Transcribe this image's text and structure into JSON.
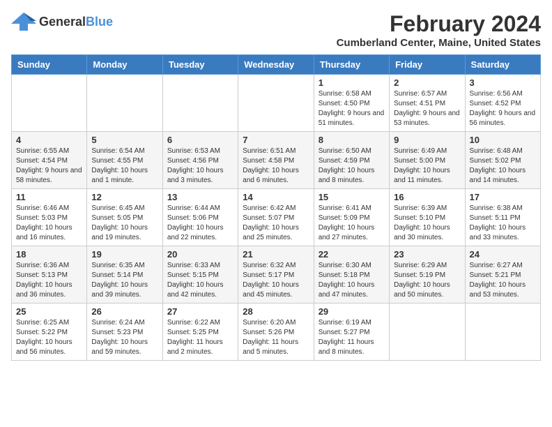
{
  "logo": {
    "line1": "General",
    "line2": "Blue"
  },
  "title": "February 2024",
  "subtitle": "Cumberland Center, Maine, United States",
  "days_of_week": [
    "Sunday",
    "Monday",
    "Tuesday",
    "Wednesday",
    "Thursday",
    "Friday",
    "Saturday"
  ],
  "weeks": [
    [
      {
        "day": "",
        "info": ""
      },
      {
        "day": "",
        "info": ""
      },
      {
        "day": "",
        "info": ""
      },
      {
        "day": "",
        "info": ""
      },
      {
        "day": "1",
        "info": "Sunrise: 6:58 AM\nSunset: 4:50 PM\nDaylight: 9 hours and 51 minutes."
      },
      {
        "day": "2",
        "info": "Sunrise: 6:57 AM\nSunset: 4:51 PM\nDaylight: 9 hours and 53 minutes."
      },
      {
        "day": "3",
        "info": "Sunrise: 6:56 AM\nSunset: 4:52 PM\nDaylight: 9 hours and 56 minutes."
      }
    ],
    [
      {
        "day": "4",
        "info": "Sunrise: 6:55 AM\nSunset: 4:54 PM\nDaylight: 9 hours and 58 minutes."
      },
      {
        "day": "5",
        "info": "Sunrise: 6:54 AM\nSunset: 4:55 PM\nDaylight: 10 hours and 1 minute."
      },
      {
        "day": "6",
        "info": "Sunrise: 6:53 AM\nSunset: 4:56 PM\nDaylight: 10 hours and 3 minutes."
      },
      {
        "day": "7",
        "info": "Sunrise: 6:51 AM\nSunset: 4:58 PM\nDaylight: 10 hours and 6 minutes."
      },
      {
        "day": "8",
        "info": "Sunrise: 6:50 AM\nSunset: 4:59 PM\nDaylight: 10 hours and 8 minutes."
      },
      {
        "day": "9",
        "info": "Sunrise: 6:49 AM\nSunset: 5:00 PM\nDaylight: 10 hours and 11 minutes."
      },
      {
        "day": "10",
        "info": "Sunrise: 6:48 AM\nSunset: 5:02 PM\nDaylight: 10 hours and 14 minutes."
      }
    ],
    [
      {
        "day": "11",
        "info": "Sunrise: 6:46 AM\nSunset: 5:03 PM\nDaylight: 10 hours and 16 minutes."
      },
      {
        "day": "12",
        "info": "Sunrise: 6:45 AM\nSunset: 5:05 PM\nDaylight: 10 hours and 19 minutes."
      },
      {
        "day": "13",
        "info": "Sunrise: 6:44 AM\nSunset: 5:06 PM\nDaylight: 10 hours and 22 minutes."
      },
      {
        "day": "14",
        "info": "Sunrise: 6:42 AM\nSunset: 5:07 PM\nDaylight: 10 hours and 25 minutes."
      },
      {
        "day": "15",
        "info": "Sunrise: 6:41 AM\nSunset: 5:09 PM\nDaylight: 10 hours and 27 minutes."
      },
      {
        "day": "16",
        "info": "Sunrise: 6:39 AM\nSunset: 5:10 PM\nDaylight: 10 hours and 30 minutes."
      },
      {
        "day": "17",
        "info": "Sunrise: 6:38 AM\nSunset: 5:11 PM\nDaylight: 10 hours and 33 minutes."
      }
    ],
    [
      {
        "day": "18",
        "info": "Sunrise: 6:36 AM\nSunset: 5:13 PM\nDaylight: 10 hours and 36 minutes."
      },
      {
        "day": "19",
        "info": "Sunrise: 6:35 AM\nSunset: 5:14 PM\nDaylight: 10 hours and 39 minutes."
      },
      {
        "day": "20",
        "info": "Sunrise: 6:33 AM\nSunset: 5:15 PM\nDaylight: 10 hours and 42 minutes."
      },
      {
        "day": "21",
        "info": "Sunrise: 6:32 AM\nSunset: 5:17 PM\nDaylight: 10 hours and 45 minutes."
      },
      {
        "day": "22",
        "info": "Sunrise: 6:30 AM\nSunset: 5:18 PM\nDaylight: 10 hours and 47 minutes."
      },
      {
        "day": "23",
        "info": "Sunrise: 6:29 AM\nSunset: 5:19 PM\nDaylight: 10 hours and 50 minutes."
      },
      {
        "day": "24",
        "info": "Sunrise: 6:27 AM\nSunset: 5:21 PM\nDaylight: 10 hours and 53 minutes."
      }
    ],
    [
      {
        "day": "25",
        "info": "Sunrise: 6:25 AM\nSunset: 5:22 PM\nDaylight: 10 hours and 56 minutes."
      },
      {
        "day": "26",
        "info": "Sunrise: 6:24 AM\nSunset: 5:23 PM\nDaylight: 10 hours and 59 minutes."
      },
      {
        "day": "27",
        "info": "Sunrise: 6:22 AM\nSunset: 5:25 PM\nDaylight: 11 hours and 2 minutes."
      },
      {
        "day": "28",
        "info": "Sunrise: 6:20 AM\nSunset: 5:26 PM\nDaylight: 11 hours and 5 minutes."
      },
      {
        "day": "29",
        "info": "Sunrise: 6:19 AM\nSunset: 5:27 PM\nDaylight: 11 hours and 8 minutes."
      },
      {
        "day": "",
        "info": ""
      },
      {
        "day": "",
        "info": ""
      }
    ]
  ]
}
